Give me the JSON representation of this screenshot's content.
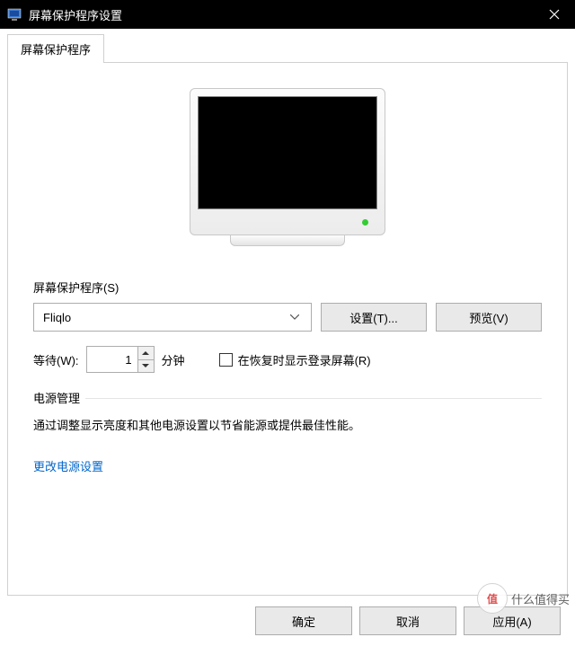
{
  "window": {
    "title": "屏幕保护程序设置"
  },
  "tab": {
    "label": "屏幕保护程序"
  },
  "screensaver": {
    "section_label": "屏幕保护程序(S)",
    "selected": "Fliqlo",
    "settings_btn": "设置(T)...",
    "preview_btn": "预览(V)"
  },
  "wait": {
    "label": "等待(W):",
    "value": "1",
    "unit": "分钟",
    "resume_label": "在恢复时显示登录屏幕(R)"
  },
  "power": {
    "group_label": "电源管理",
    "description": "通过调整显示亮度和其他电源设置以节省能源或提供最佳性能。",
    "link": "更改电源设置"
  },
  "footer": {
    "ok": "确定",
    "cancel": "取消",
    "apply": "应用(A)"
  },
  "watermark": {
    "badge": "值",
    "text": "什么值得买"
  }
}
